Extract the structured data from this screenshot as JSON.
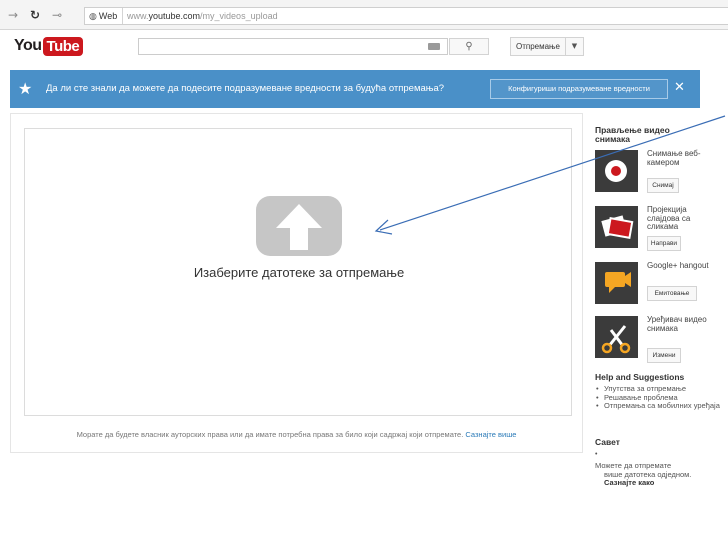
{
  "browser": {
    "url_site": "Web",
    "url_prefix": "www.",
    "url_domain": "youtube.com",
    "url_path": "/my_videos_upload"
  },
  "header": {
    "logo_you": "You",
    "logo_tube": "Tube",
    "search_placeholder": "",
    "upload_label": "Отпремање"
  },
  "banner": {
    "text": "Да ли сте знали да можете да подесите подразумеване вредности за будућа отпремања?",
    "button_label": "Конфигуриши подразумеване вредности",
    "close_label": "✕"
  },
  "main": {
    "drop_label": "Изаберите датотеке за отпремање",
    "rights_text": "Морате да будете власник ауторских права или да имате потребна права за било који садржај који отпремате.",
    "rights_link": "Сазнајте више"
  },
  "sidebar": {
    "heading": "Прављење видео снимака",
    "tools": [
      {
        "label": "Снимање веб-камером",
        "button": "Снимај",
        "icon": "record-icon"
      },
      {
        "label": "Пројекција слајдова са сликама",
        "button": "Направи",
        "icon": "photos-icon"
      },
      {
        "label": "Google+ hangout",
        "button": "Емитовање",
        "icon": "hangout-icon"
      },
      {
        "label": "Уређивач видео снимака",
        "button": "Измени",
        "icon": "scissors-icon"
      }
    ],
    "help_heading": "Help and Suggestions",
    "help_items": [
      "Упутства за отпремање",
      "Решавање проблема",
      "Отпремања са мобилних уређаја"
    ],
    "tip_heading": "Савет",
    "tip_dot": "•",
    "tip_text": "Можете да отпремате",
    "tip_text2": "више датотека одједном.",
    "tip_link": "Сазнајте како"
  },
  "colors": {
    "banner": "#4a90c8",
    "brand_red": "#cc181e",
    "arrow": "#3a6db5"
  }
}
